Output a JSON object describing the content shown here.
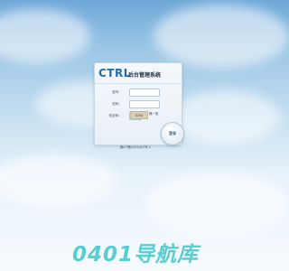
{
  "login": {
    "logo_text": "CTRL",
    "system_title": "后台管理系统",
    "username_label": "账号：",
    "password_label": "密码：",
    "captcha_label": "验证码：",
    "captcha_code": "KR6",
    "refresh_text": "换一张",
    "login_button": "登录",
    "footer_note": "备ICP备2025/0/7号-1"
  },
  "watermark": {
    "text": "0401导航库"
  }
}
